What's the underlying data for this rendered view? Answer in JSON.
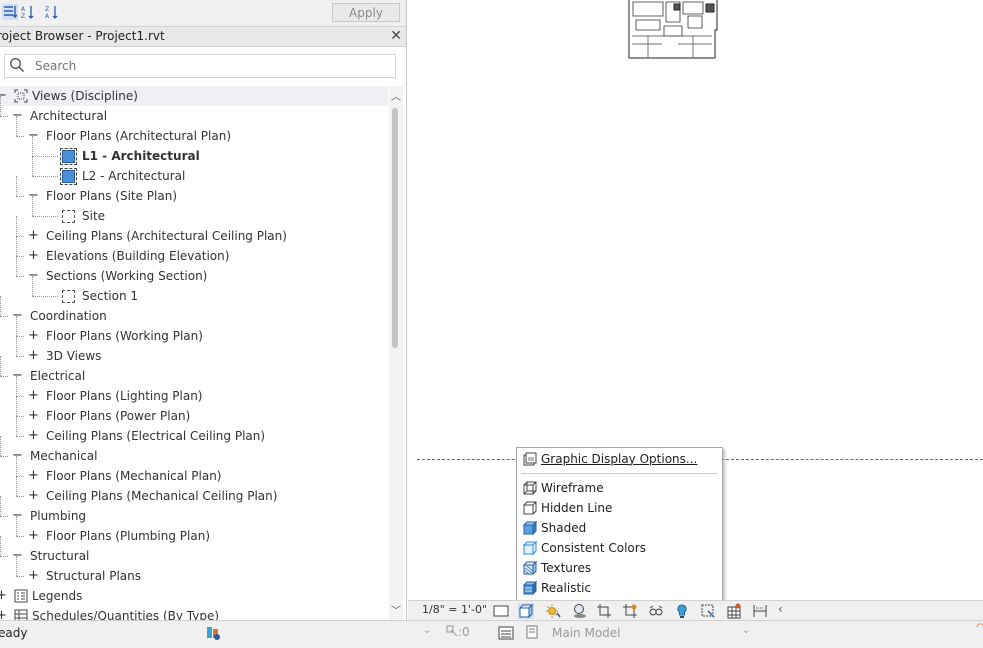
{
  "properties_toolbar": {
    "apply_label": "Apply"
  },
  "project_browser": {
    "title": "roject Browser - Project1.rvt",
    "close_glyph": "✕",
    "search_placeholder": "Search",
    "tree": [
      {
        "level": 0,
        "expander": "−",
        "icon": "views",
        "label": "Views (Discipline)"
      },
      {
        "level": 1,
        "expander": "−",
        "label": "Architectural"
      },
      {
        "level": 2,
        "expander": "−",
        "label": "Floor Plans (Architectural Plan)"
      },
      {
        "level": 3,
        "icon": "view-blue",
        "label": "L1 - Architectural",
        "bold": true
      },
      {
        "level": 3,
        "icon": "view-blue",
        "label": "L2 - Architectural"
      },
      {
        "level": 2,
        "expander": "−",
        "label": "Floor Plans (Site Plan)"
      },
      {
        "level": 3,
        "icon": "view",
        "label": "Site"
      },
      {
        "level": 2,
        "expander": "+",
        "label": "Ceiling Plans (Architectural Ceiling Plan)"
      },
      {
        "level": 2,
        "expander": "+",
        "label": "Elevations (Building Elevation)"
      },
      {
        "level": 2,
        "expander": "−",
        "label": "Sections (Working Section)"
      },
      {
        "level": 3,
        "icon": "view",
        "label": "Section 1"
      },
      {
        "level": 1,
        "expander": "−",
        "label": "Coordination"
      },
      {
        "level": 2,
        "expander": "+",
        "label": "Floor Plans (Working Plan)"
      },
      {
        "level": 2,
        "expander": "+",
        "label": "3D Views"
      },
      {
        "level": 1,
        "expander": "−",
        "label": "Electrical"
      },
      {
        "level": 2,
        "expander": "+",
        "label": "Floor Plans (Lighting Plan)"
      },
      {
        "level": 2,
        "expander": "+",
        "label": "Floor Plans (Power Plan)"
      },
      {
        "level": 2,
        "expander": "+",
        "label": "Ceiling Plans (Electrical Ceiling Plan)"
      },
      {
        "level": 1,
        "expander": "−",
        "label": "Mechanical"
      },
      {
        "level": 2,
        "expander": "+",
        "label": "Floor Plans (Mechanical Plan)"
      },
      {
        "level": 2,
        "expander": "+",
        "label": "Ceiling Plans (Mechanical Ceiling Plan)"
      },
      {
        "level": 1,
        "expander": "−",
        "label": "Plumbing"
      },
      {
        "level": 2,
        "expander": "+",
        "label": "Floor Plans (Plumbing Plan)"
      },
      {
        "level": 1,
        "expander": "−",
        "label": "Structural"
      },
      {
        "level": 2,
        "expander": "+",
        "label": "Structural Plans"
      },
      {
        "level": 0,
        "expander": "+",
        "icon": "legend",
        "label": "Legends"
      },
      {
        "level": 0,
        "expander": "+",
        "icon": "schedule",
        "label": "Schedules/Quantities (By Type)"
      }
    ]
  },
  "visual_style_menu": {
    "items": [
      {
        "label": "Graphic Display Options...",
        "icon": "graphic-display-options-icon",
        "underline": true
      },
      {
        "label": "Wireframe",
        "icon": "wireframe-icon"
      },
      {
        "label": "Hidden Line",
        "icon": "hidden-line-icon"
      },
      {
        "label": "Shaded",
        "icon": "shaded-icon"
      },
      {
        "label": "Consistent Colors",
        "icon": "consistent-colors-icon"
      },
      {
        "label": "Textures",
        "icon": "textures-icon"
      },
      {
        "label": "Realistic",
        "icon": "realistic-icon"
      }
    ]
  },
  "view_control_bar": {
    "scale": "1/8\" = 1'-0\""
  },
  "status_bar": {
    "status_text": "eady",
    "selection_count": ":0",
    "active_model": "Main Model"
  },
  "colors": {
    "accent_blue": "#4a90d9",
    "dash_green": "#2e8b3c"
  }
}
